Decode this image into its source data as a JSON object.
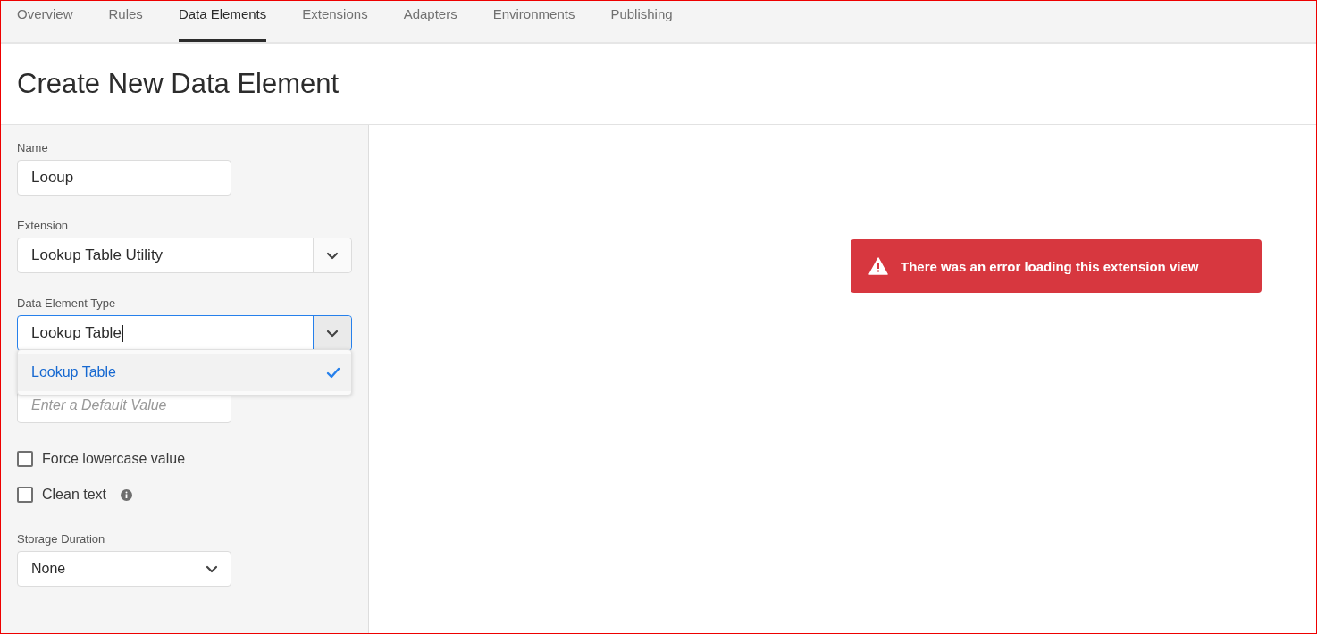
{
  "tabs": [
    {
      "label": "Overview",
      "selected": false
    },
    {
      "label": "Rules",
      "selected": false
    },
    {
      "label": "Data Elements",
      "selected": true
    },
    {
      "label": "Extensions",
      "selected": false
    },
    {
      "label": "Adapters",
      "selected": false
    },
    {
      "label": "Environments",
      "selected": false
    },
    {
      "label": "Publishing",
      "selected": false
    }
  ],
  "heading": "Create New Data Element",
  "form": {
    "name": {
      "label": "Name",
      "value": "Looup"
    },
    "extension": {
      "label": "Extension",
      "value": "Lookup Table Utility"
    },
    "type": {
      "label": "Data Element Type",
      "value": "Lookup Table",
      "focused": true,
      "options": [
        {
          "label": "Lookup Table",
          "selected": true
        }
      ]
    },
    "default_value": {
      "placeholder": "Enter a Default Value"
    },
    "checkboxes": [
      {
        "label": "Force lowercase value",
        "checked": false,
        "info": false
      },
      {
        "label": "Clean text",
        "checked": false,
        "info": true
      }
    ],
    "storage": {
      "label": "Storage Duration",
      "value": "None"
    }
  },
  "error": {
    "message": "There was an error loading this extension view"
  }
}
